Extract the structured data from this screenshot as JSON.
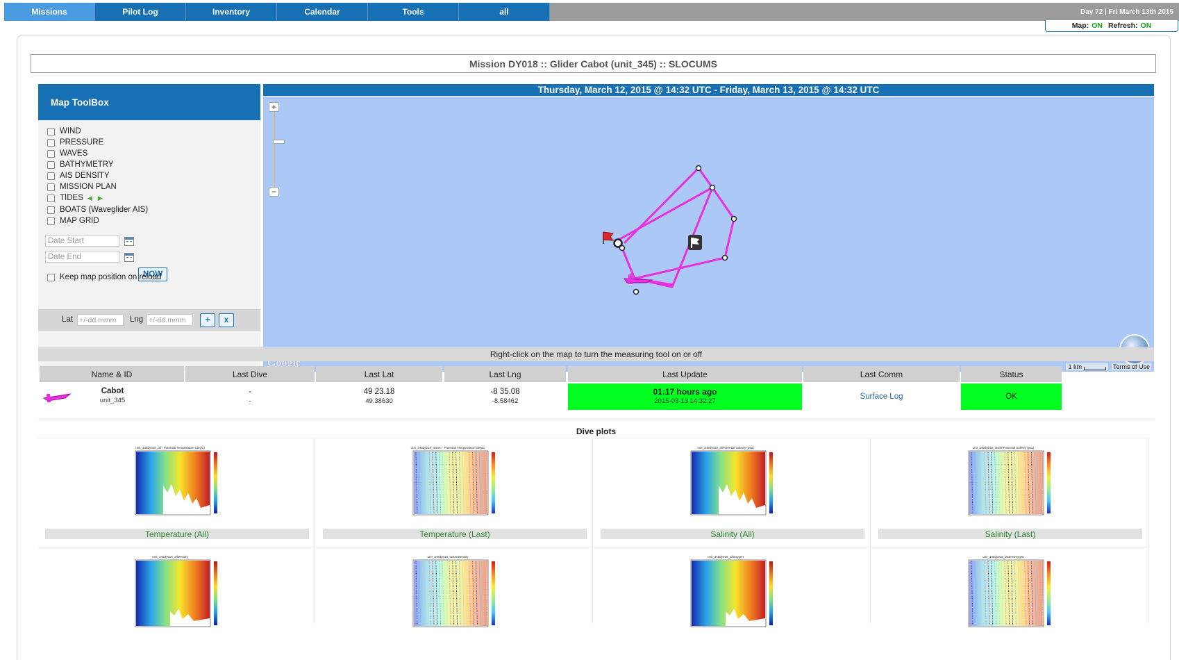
{
  "nav": {
    "tabs": [
      "Missions",
      "Pilot Log",
      "Inventory",
      "Calendar",
      "Tools",
      "all"
    ],
    "day_label": "Day 72 | Fri March 13th 2015",
    "map_label": "Map:",
    "map_value": "ON",
    "refresh_label": "Refresh:",
    "refresh_value": "ON"
  },
  "mission_title": "Mission DY018 :: Glider Cabot (unit_345) :: SLOCUMS",
  "toolbox": {
    "title": "Map ToolBox",
    "layers": [
      "WIND",
      "PRESSURE",
      "WAVES",
      "BATHYMETRY",
      "AIS DENSITY",
      "MISSION PLAN",
      "TIDES",
      "BOATS (Waveglider AIS)",
      "MAP GRID"
    ],
    "date_start_placeholder": "Date Start",
    "date_end_placeholder": "Date End",
    "now_label": "NOW",
    "keep_position_label": "Keep map position on reload",
    "lat_label": "Lat",
    "lat_placeholder": "+/-dd.mmm",
    "lng_label": "Lng",
    "lng_placeholder": "+/-dd.mmm",
    "add_label": "+",
    "clear_label": "x"
  },
  "map": {
    "date_range": "Thursday, March 12, 2015 @ 14:32 UTC - Friday, March 13, 2015 @ 14:32 UTC",
    "track_color": "#e82ee0",
    "background_color": "#abc8f7",
    "provider_logo": "Google",
    "scale_label": "1 km",
    "terms_label": "Terms of Use",
    "hint": "Right-click on the map to turn the measuring tool on or off"
  },
  "table": {
    "headers": [
      "Name & ID",
      "Last Dive",
      "Last Lat",
      "Last Lng",
      "Last Update",
      "Last Comm",
      "Status"
    ],
    "row": {
      "name": "Cabot",
      "id": "unit_345",
      "last_dive_1": "-",
      "last_dive_2": "-",
      "lat_dm": "49 23.18",
      "lat_dec": "49.38630",
      "lng_dm": "-8 35.08",
      "lng_dec": "-8.58462",
      "update_ago": "01:17 hours ago",
      "update_time": "2015-03-13 14:32:27",
      "last_comm": "Surface Log",
      "status": "OK"
    },
    "status_color": "#00ff21"
  },
  "plots": {
    "title": "Dive plots",
    "items": [
      {
        "caption": "Temperature (All)",
        "plot_title": "unit_345dy018_all - Potential Temperature (degC)"
      },
      {
        "caption": "Temperature (Last)",
        "plot_title": "unit_345dy018_lasten - Potential Temperature (degC)"
      },
      {
        "caption": "Salinity (All)",
        "plot_title": "unit_345dy018_allPotential Salinity (psu)"
      },
      {
        "caption": "Salinity (Last)",
        "plot_title": "unit_345dy018_lastenPotential Salinity (psu)"
      },
      {
        "caption": "",
        "plot_title": "unit_345dy018_allDensity"
      },
      {
        "caption": "",
        "plot_title": "unit_345dy018_lastenDensity"
      },
      {
        "caption": "",
        "plot_title": "unit_345dy018_allOxygen"
      },
      {
        "caption": "",
        "plot_title": "unit_345dy018_lastenOxygen"
      }
    ]
  }
}
